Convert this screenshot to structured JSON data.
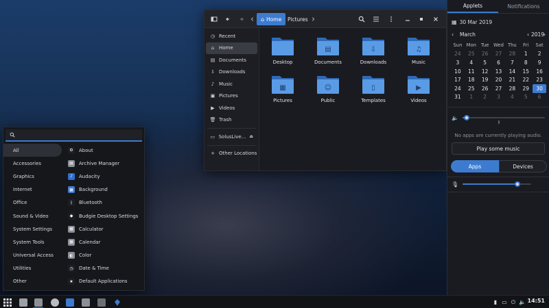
{
  "file_manager": {
    "breadcrumbs": [
      "Home",
      "Pictures"
    ],
    "sidebar": [
      {
        "label": "Recent",
        "icon": "clock-icon"
      },
      {
        "label": "Home",
        "icon": "home-icon",
        "active": true
      },
      {
        "label": "Documents",
        "icon": "document-icon"
      },
      {
        "label": "Downloads",
        "icon": "download-icon"
      },
      {
        "label": "Music",
        "icon": "music-icon"
      },
      {
        "label": "Pictures",
        "icon": "picture-icon"
      },
      {
        "label": "Videos",
        "icon": "video-icon"
      },
      {
        "label": "Trash",
        "icon": "trash-icon"
      }
    ],
    "device": {
      "label": "SolusLive...",
      "icon": "drive-icon"
    },
    "other_locations": "Other Locations",
    "folders": [
      {
        "label": "Desktop",
        "icon": "desktop-folder-icon"
      },
      {
        "label": "Documents",
        "icon": "documents-folder-icon"
      },
      {
        "label": "Downloads",
        "icon": "downloads-folder-icon"
      },
      {
        "label": "Music",
        "icon": "music-folder-icon"
      },
      {
        "label": "Pictures",
        "icon": "pictures-folder-icon"
      },
      {
        "label": "Public",
        "icon": "public-folder-icon"
      },
      {
        "label": "Templates",
        "icon": "templates-folder-icon"
      },
      {
        "label": "Videos",
        "icon": "videos-folder-icon"
      }
    ]
  },
  "raven": {
    "tabs": [
      "Applets",
      "Notifications"
    ],
    "date": "30 Mar 2019",
    "month": "March",
    "year": "2019",
    "weekdays": [
      "Sun",
      "Mon",
      "Tue",
      "Wed",
      "Thu",
      "Fri",
      "Sat"
    ],
    "weeks": [
      [
        "24",
        "25",
        "26",
        "27",
        "28",
        "1",
        "2"
      ],
      [
        "3",
        "4",
        "5",
        "6",
        "7",
        "8",
        "9"
      ],
      [
        "10",
        "11",
        "12",
        "13",
        "14",
        "15",
        "16"
      ],
      [
        "17",
        "18",
        "19",
        "20",
        "21",
        "22",
        "23"
      ],
      [
        "24",
        "25",
        "26",
        "27",
        "28",
        "29",
        "30"
      ],
      [
        "31",
        "1",
        "2",
        "3",
        "4",
        "5",
        "6"
      ]
    ],
    "dim_cells": [
      [
        0,
        0
      ],
      [
        0,
        1
      ],
      [
        0,
        2
      ],
      [
        0,
        3
      ],
      [
        0,
        4
      ],
      [
        5,
        1
      ],
      [
        5,
        2
      ],
      [
        5,
        3
      ],
      [
        5,
        4
      ],
      [
        5,
        5
      ],
      [
        5,
        6
      ]
    ],
    "today_cell": [
      4,
      6
    ],
    "no_audio": "No apps are currently playing audio.",
    "play_button": "Play some music",
    "seg_apps": "Apps",
    "seg_devices": "Devices",
    "volume_level": 0.05,
    "mic_level": 0.8
  },
  "menu": {
    "search_placeholder": "",
    "categories": [
      "All",
      "Accessories",
      "Graphics",
      "Internet",
      "Office",
      "Sound & Video",
      "System Settings",
      "System Tools",
      "Universal Access",
      "Utilities",
      "Other"
    ],
    "apps": [
      {
        "label": "About",
        "color": "#1d1e23",
        "glyph": "⚙"
      },
      {
        "label": "Archive Manager",
        "color": "#8a8f98",
        "glyph": "▤"
      },
      {
        "label": "Audacity",
        "color": "#2f6fd0",
        "glyph": "♪"
      },
      {
        "label": "Background",
        "color": "#3d7bd0",
        "glyph": "▦"
      },
      {
        "label": "Bluetooth",
        "color": "#1d1e23",
        "glyph": "ᛒ"
      },
      {
        "label": "Budgie Desktop Settings",
        "color": "#1d1e23",
        "glyph": "◆"
      },
      {
        "label": "Calculator",
        "color": "#8a8f98",
        "glyph": "▦"
      },
      {
        "label": "Calendar",
        "color": "#8a8f98",
        "glyph": "▦"
      },
      {
        "label": "Color",
        "color": "#8a8f98",
        "glyph": "◐"
      },
      {
        "label": "Date & Time",
        "color": "#1d1e23",
        "glyph": "◷"
      },
      {
        "label": "Default Applications",
        "color": "#1d1e23",
        "glyph": "★"
      }
    ]
  },
  "panel": {
    "clock": "14:51",
    "launchers": [
      "menu-grid-icon",
      "files-icon",
      "nautilus-icon",
      "settings-icon",
      "software-icon",
      "terminal-icon",
      "budgie-icon"
    ]
  },
  "colors": {
    "accent": "#3d7bd0"
  }
}
